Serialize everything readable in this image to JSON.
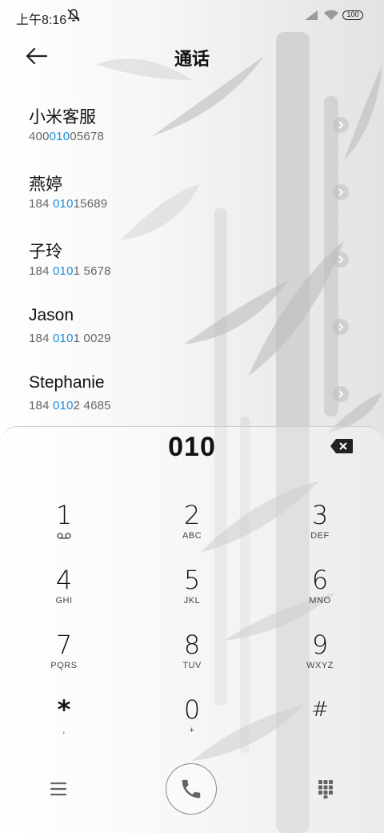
{
  "status_bar": {
    "time": "上午8:16",
    "battery": "100"
  },
  "header": {
    "title": "通话"
  },
  "results": [
    {
      "name": "小米客服",
      "number_pre": "400",
      "number_match": "010",
      "number_post": "05678"
    },
    {
      "name": "燕婷",
      "number_pre": "184 ",
      "number_match": "010",
      "number_post": "15689"
    },
    {
      "name": "子玲",
      "number_pre": "184 ",
      "number_match": "010",
      "number_post": "1 5678"
    },
    {
      "name": "Jason",
      "number_pre": "184 ",
      "number_match": "010",
      "number_post": "1 0029"
    },
    {
      "name": "Stephanie",
      "number_pre": "184 ",
      "number_match": "010",
      "number_post": "2 4685"
    }
  ],
  "dialpad": {
    "number": "010",
    "keys": [
      {
        "digit": "1",
        "letters": ""
      },
      {
        "digit": "2",
        "letters": "ABC"
      },
      {
        "digit": "3",
        "letters": "DEF"
      },
      {
        "digit": "4",
        "letters": "GHI"
      },
      {
        "digit": "5",
        "letters": "JKL"
      },
      {
        "digit": "6",
        "letters": "MNO"
      },
      {
        "digit": "7",
        "letters": "PQRS"
      },
      {
        "digit": "8",
        "letters": "TUV"
      },
      {
        "digit": "9",
        "letters": "WXYZ"
      },
      {
        "digit": "*",
        "letters": ","
      },
      {
        "digit": "0",
        "letters": "+"
      },
      {
        "digit": "#",
        "letters": ""
      }
    ]
  },
  "colors": {
    "highlight": "#1a8ee0"
  },
  "icons": {
    "back": "back-arrow-icon",
    "chevron": "chevron-right-icon",
    "backspace": "backspace-icon",
    "voicemail": "voicemail-icon",
    "menu": "menu-icon",
    "call": "phone-icon",
    "keypad": "keypad-icon"
  }
}
